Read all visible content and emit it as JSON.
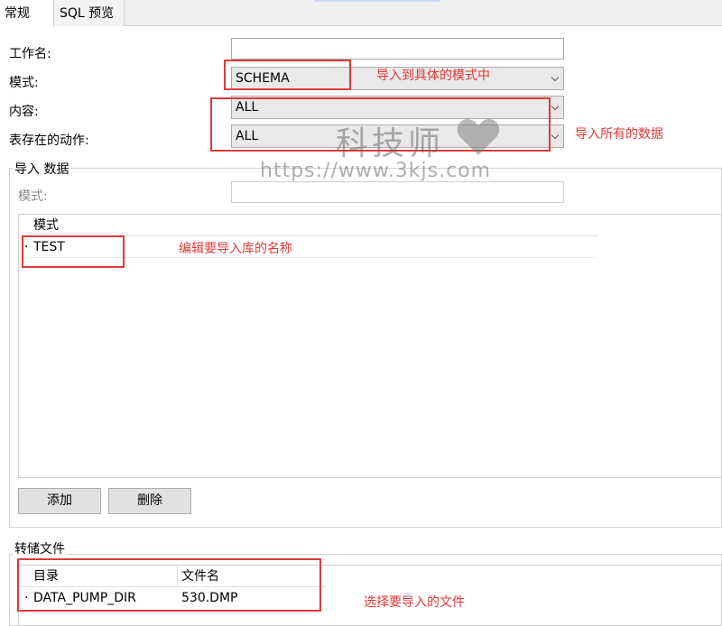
{
  "tabs": {
    "general": "常规",
    "sql_preview": "SQL 预览"
  },
  "form": {
    "job_name_label": "工作名:",
    "job_name_value": "",
    "mode_label": "模式:",
    "mode_value": "SCHEMA",
    "content_label": "内容:",
    "content_value": "ALL",
    "table_exists_label": "表存在的动作:",
    "table_exists_value": "ALL"
  },
  "import_group": {
    "title": "导入 数据",
    "schema_label": "模式:",
    "schema_value": "",
    "grid_header": "模式",
    "rows": [
      {
        "mark": "·",
        "name": "TEST"
      }
    ],
    "add_button": "添加",
    "delete_button": "删除"
  },
  "dump_group": {
    "title": "转储文件",
    "col_directory": "目录",
    "col_filename": "文件名",
    "rows": [
      {
        "mark": "·",
        "directory": "DATA_PUMP_DIR",
        "filename": "530.DMP"
      }
    ]
  },
  "annotations": {
    "mode_note": "导入到具体的模式中",
    "all_note": "导入所有的数据",
    "schema_note": "编辑要导入库的名称",
    "file_note": "选择要导入的文件",
    "color": "#e03a3a"
  },
  "watermark": {
    "title": "科技师",
    "url": "https://www.3kjs.com",
    "icon": "heart-icon"
  }
}
